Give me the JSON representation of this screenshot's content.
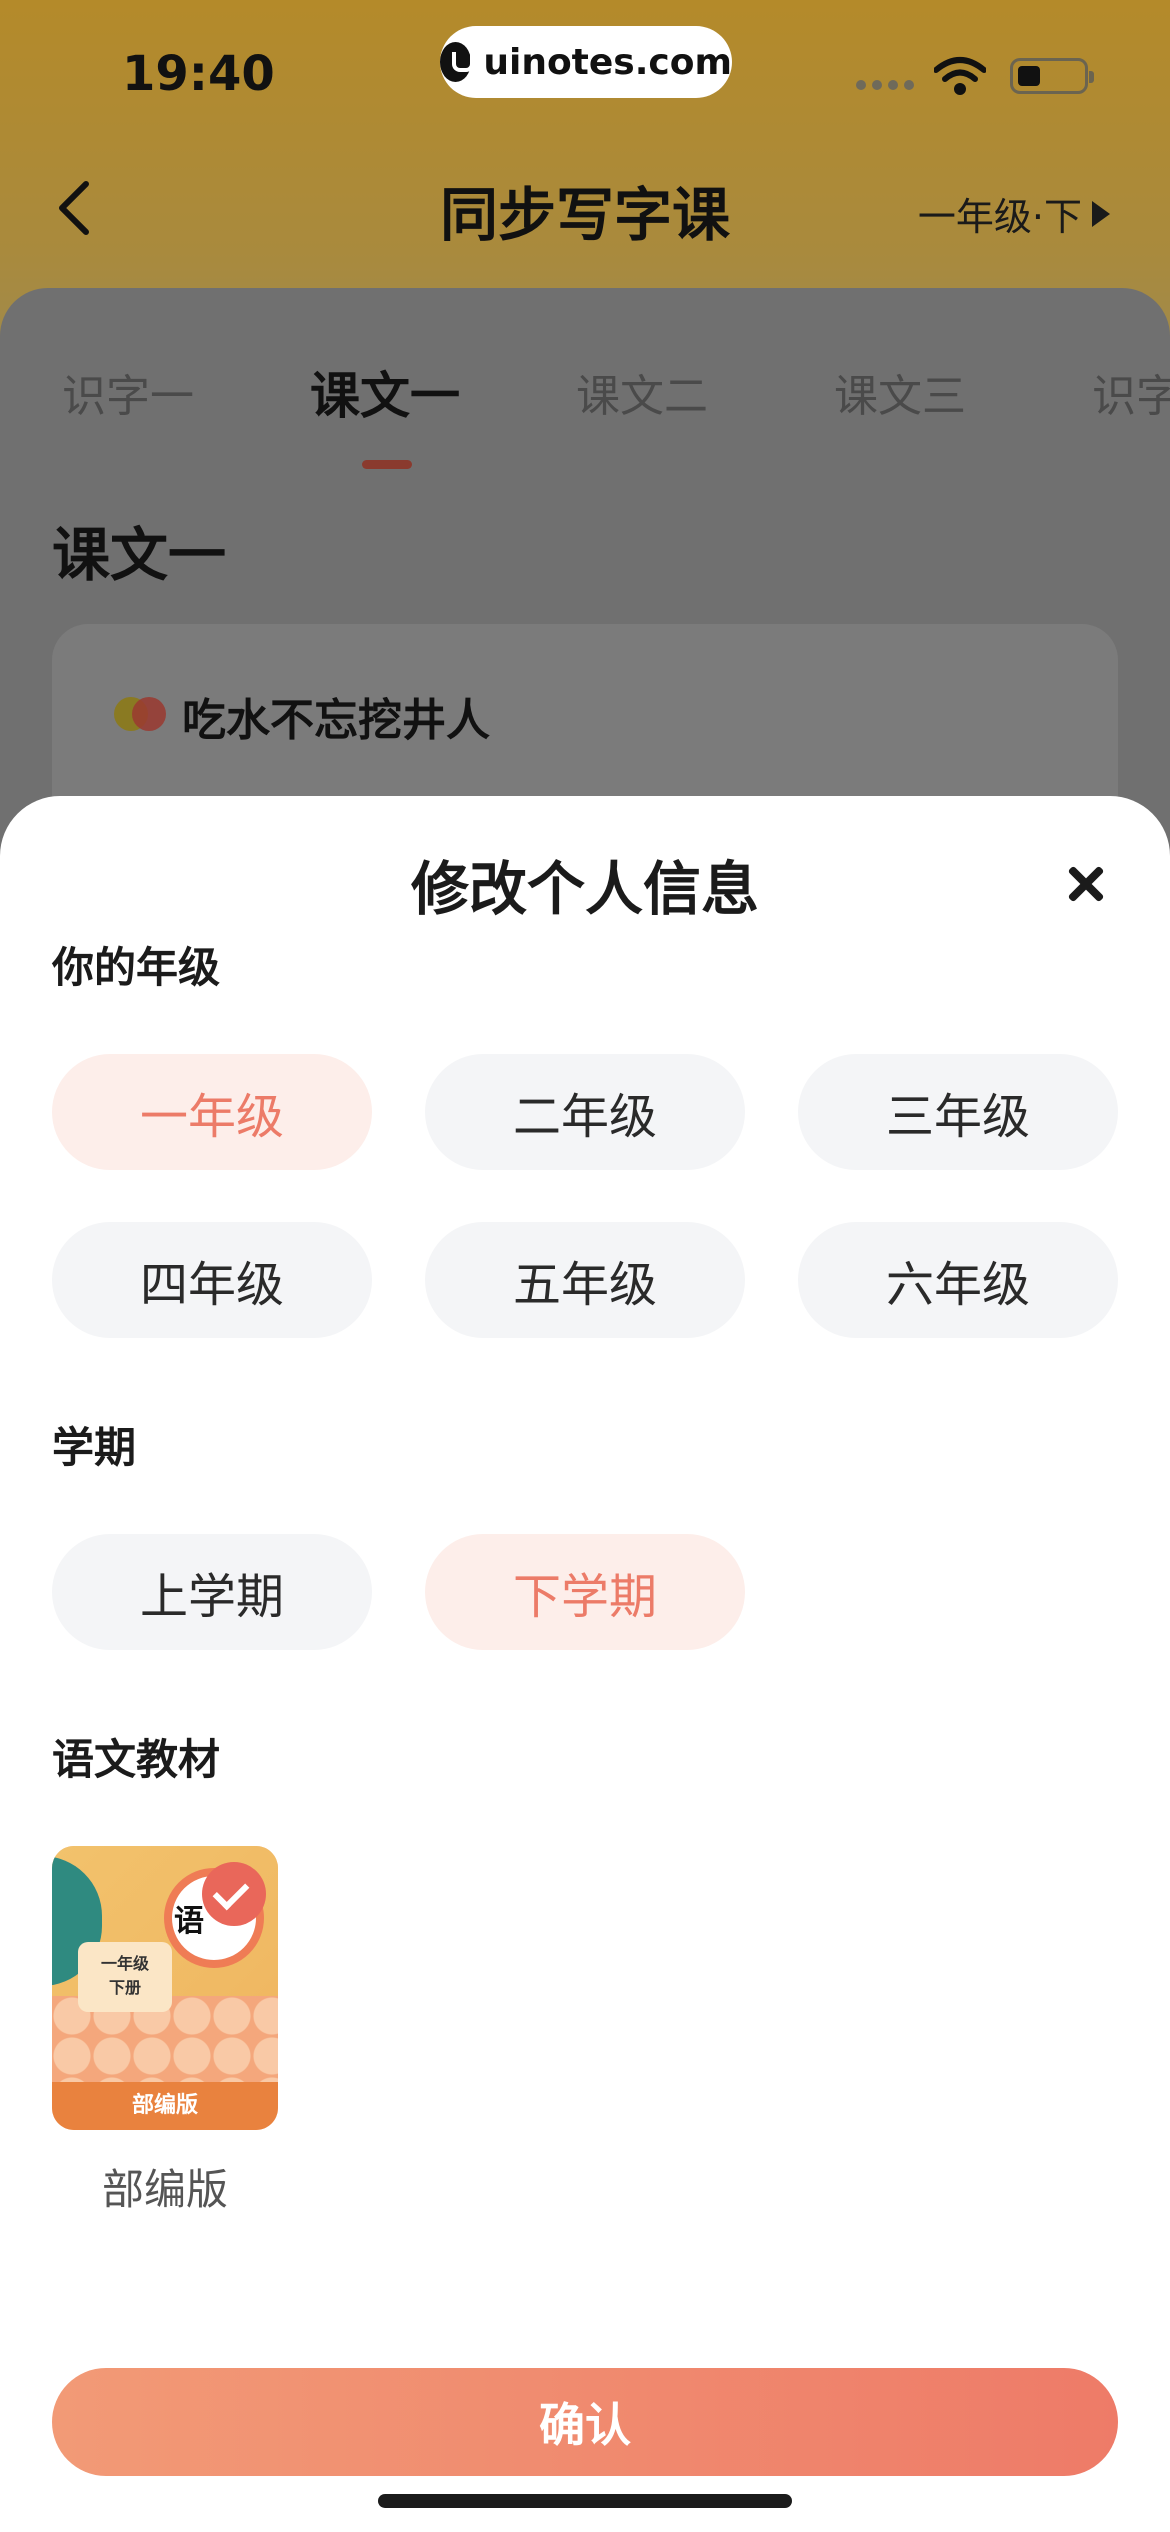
{
  "status_bar": {
    "time": "19:40",
    "watermark": "uinotes.com"
  },
  "nav": {
    "title": "同步写字课",
    "grade_switch": "一年级·下"
  },
  "tabs": [
    {
      "label": "识字一",
      "active": false
    },
    {
      "label": "课文一",
      "active": true
    },
    {
      "label": "课文二",
      "active": false
    },
    {
      "label": "课文三",
      "active": false
    },
    {
      "label": "识字",
      "active": false
    }
  ],
  "content": {
    "section_title": "课文一",
    "lesson": "吃水不忘挖井人"
  },
  "sheet": {
    "title": "修改个人信息",
    "grade_label": "你的年级",
    "grades": [
      {
        "label": "一年级",
        "selected": true
      },
      {
        "label": "二年级",
        "selected": false
      },
      {
        "label": "三年级",
        "selected": false
      },
      {
        "label": "四年级",
        "selected": false
      },
      {
        "label": "五年级",
        "selected": false
      },
      {
        "label": "六年级",
        "selected": false
      }
    ],
    "semester_label": "学期",
    "semesters": [
      {
        "label": "上学期",
        "selected": false
      },
      {
        "label": "下学期",
        "selected": true
      }
    ],
    "textbook_label": "语文教材",
    "textbook": {
      "cover_title": "语",
      "cover_grade_line1": "一年级",
      "cover_grade_line2": "下册",
      "cover_footer": "部编版",
      "caption": "部编版",
      "selected": true
    },
    "confirm_label": "确认"
  },
  "colors": {
    "accent": "#ee7b68",
    "selected_chip_bg": "#fdeeea",
    "chip_bg": "#f4f5f7"
  }
}
